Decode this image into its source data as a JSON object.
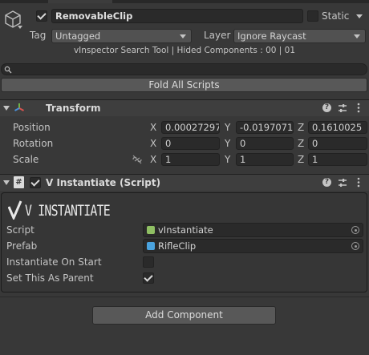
{
  "header": {
    "object_name": "RemovableClip",
    "static_label": "Static",
    "tag_label": "Tag",
    "tag_value": "Untagged",
    "layer_label": "Layer",
    "layer_value": "Ignore Raycast",
    "active": true,
    "static": false
  },
  "vinspector": {
    "info": "vInspector Search Tool | Hided Components : 00 | 01",
    "search_placeholder": "",
    "fold_button": "Fold All Scripts"
  },
  "transform": {
    "title": "Transform",
    "rows": [
      {
        "label": "Position",
        "x": "0.00027297",
        "y": "-0.0197071",
        "z": "0.1610025"
      },
      {
        "label": "Rotation",
        "x": "0",
        "y": "0",
        "z": "0"
      },
      {
        "label": "Scale",
        "x": "1",
        "y": "1",
        "z": "1"
      }
    ],
    "axis_x": "X",
    "axis_y": "Y",
    "axis_z": "Z"
  },
  "instantiate": {
    "title": "V Instantiate (Script)",
    "banner": "V INSTANTIATE",
    "enabled": true,
    "fields": [
      {
        "label": "Script",
        "value": "vInstantiate"
      },
      {
        "label": "Prefab",
        "value": "RifleClip"
      }
    ],
    "toggles": [
      {
        "label": "Instantiate On Start",
        "checked": false
      },
      {
        "label": "Set This As Parent",
        "checked": true
      }
    ]
  },
  "add_component_button": "Add Component",
  "colors": {
    "background": "#383838",
    "field": "#2a2a2a",
    "prefab_icon": "#4aa3df",
    "script_icon": "#8fbf63"
  }
}
